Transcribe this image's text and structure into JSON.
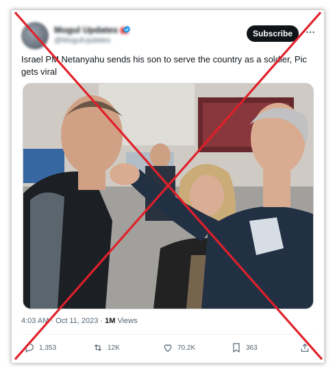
{
  "tweet": {
    "author_name": "Mogul Updates",
    "author_handle": "@MogulUpdates",
    "subscribe_label": "Subscribe",
    "text": "Israel PM Netanyahu sends his son to serve the country as a soldier, Pic gets viral",
    "time": "4:03 AM",
    "separator": "·",
    "date": "Oct 11, 2023",
    "views_count": "1M",
    "views_label": "Views"
  },
  "actions": {
    "replies": "1,353",
    "retweets": "12K",
    "likes": "70.2K",
    "bookmarks": "363"
  },
  "colors": {
    "accent": "#1d9bf0",
    "cross": "#e0202a",
    "button": "#0f1419"
  },
  "icons": [
    "verified-badge-icon",
    "more-options-icon",
    "reply-icon",
    "retweet-icon",
    "like-icon",
    "bookmark-icon",
    "share-icon"
  ]
}
